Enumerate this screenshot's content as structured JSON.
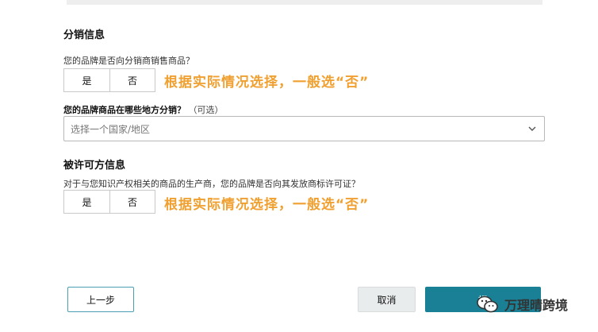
{
  "distribution": {
    "title": "分销信息",
    "question": "您的品牌是否向分销商销售商品？",
    "options": [
      "是",
      "否"
    ],
    "note": "根据实际情况选择，一般选“否”"
  },
  "region": {
    "question": "您的品牌商品在哪些地方分销？",
    "optional": "（可选）",
    "placeholder": "选择一个国家/地区"
  },
  "licensor": {
    "title": "被许可方信息",
    "question": "对于与您知识产权相关的商品的生产商，您的品牌是否向其发放商标许可证？",
    "options": [
      "是",
      "否"
    ],
    "note": "根据实际情况选择，一般选“否”"
  },
  "buttons": {
    "prev": "上一步",
    "cancel": "取消",
    "submit": "提"
  },
  "watermark": {
    "text": "万理晴跨境",
    "icon": "wechat-icon"
  },
  "colors": {
    "accent": "#1a8096",
    "note": "#f0a030",
    "prev_border": "#4a9fb4"
  }
}
